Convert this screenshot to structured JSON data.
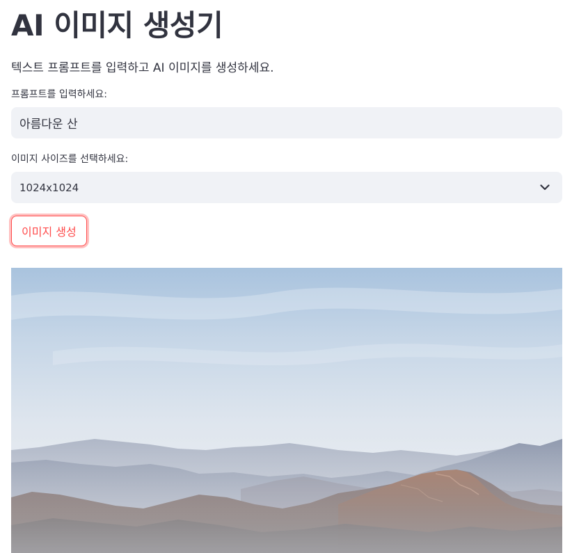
{
  "page": {
    "title": "AI 이미지 생성기",
    "description": "텍스트 프롬프트를 입력하고 AI 이미지를 생성하세요."
  },
  "prompt": {
    "label": "프롬프트를 입력하세요:",
    "value": "아름다운 산"
  },
  "size": {
    "label": "이미지 사이즈를 선택하세요:",
    "selected": "1024x1024",
    "icon": "chevron-down-icon"
  },
  "generate_button": {
    "label": "이미지 생성",
    "color": "#ff4b4b"
  },
  "result_image": {
    "subject": "mountain landscape"
  },
  "colors": {
    "accent": "#ff4b4b",
    "text": "#31333f",
    "input_bg": "#f0f2f6"
  }
}
